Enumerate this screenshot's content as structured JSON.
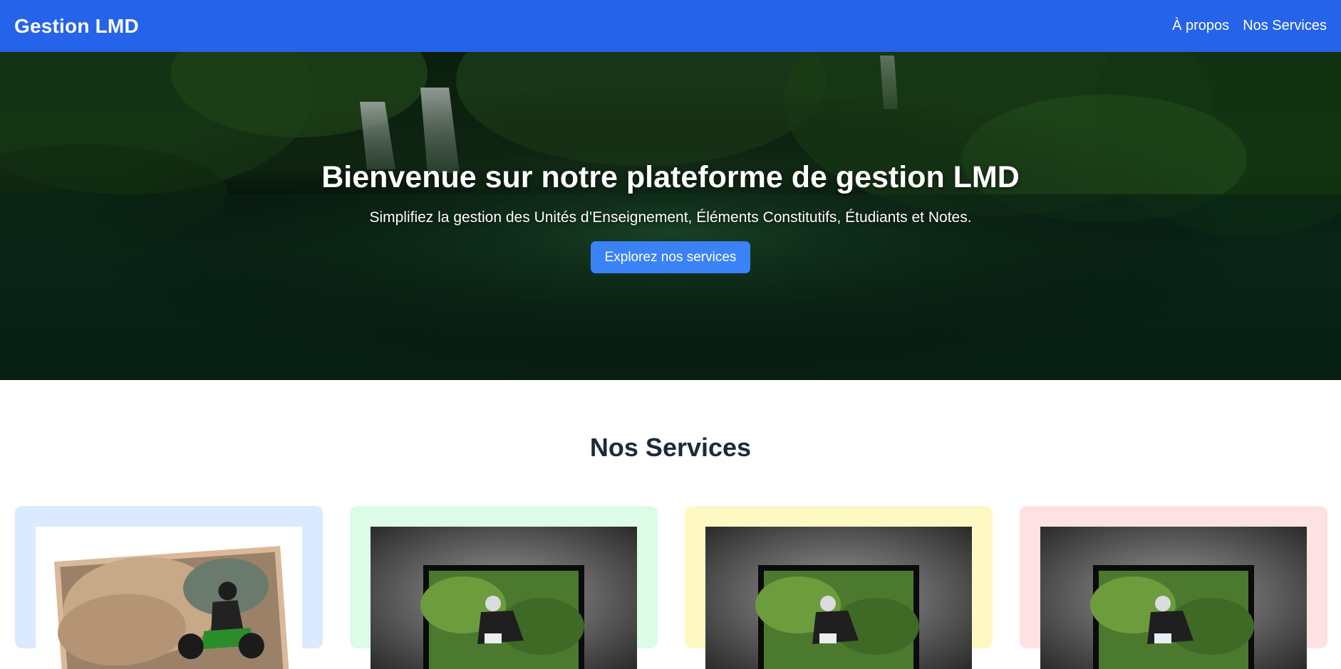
{
  "navbar": {
    "brand": "Gestion LMD",
    "links": [
      "À propos",
      "Nos Services"
    ],
    "color": "#2563eb"
  },
  "hero": {
    "title": "Bienvenue sur notre plateforme de gestion LMD",
    "subtitle": "Simplifiez la gestion des Unités d’Enseignement, Éléments Constitutifs, Étudiants et Notes.",
    "button_label": "Explorez nos services",
    "button_color": "#3b82f6"
  },
  "services": {
    "title": "Nos Services",
    "cards": [
      {
        "bg": "#dbeafe",
        "image": "motocross-photo"
      },
      {
        "bg": "#dcfce7",
        "image": "mountain-bike-photo"
      },
      {
        "bg": "#fef9c3",
        "image": "mountain-bike-photo"
      },
      {
        "bg": "#fee2e2",
        "image": "mountain-bike-photo"
      }
    ]
  }
}
